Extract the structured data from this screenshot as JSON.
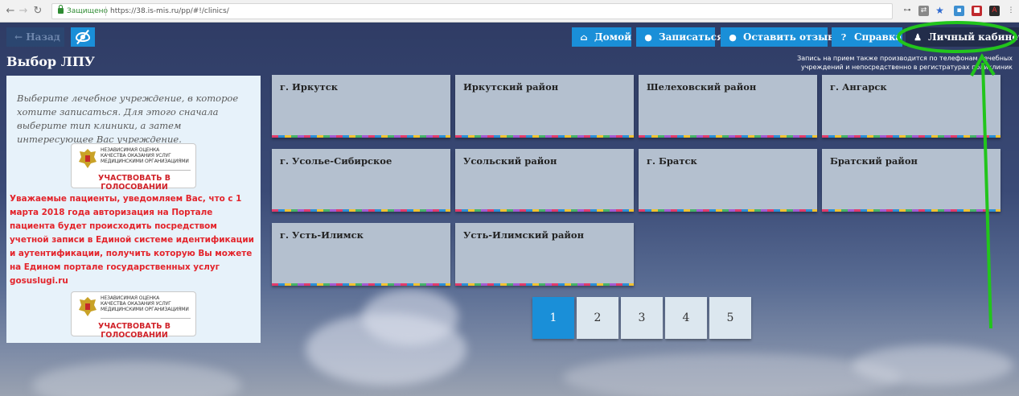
{
  "browser": {
    "secure_label": "Защищено",
    "url": "https://38.is-mis.ru/pp/#!/clinics/"
  },
  "topnav": {
    "back_label": "Назад",
    "home_label": "Домой",
    "signup_label": "Записаться",
    "feedback_label": "Оставить отзыв",
    "help_label": "Справка",
    "cabinet_label": "Личный кабинет"
  },
  "page": {
    "title": "Выбор ЛПУ",
    "note": "Запись на прием также производится по телефонам лечебных учреждений и непосредственно в регистратурах поликлиник"
  },
  "leftpanel": {
    "intro": "Выберите лечебное учреждение, в которое хотите записаться. Для этого сначала выберите тип клиники, а затем интересующее Вас учреждение.",
    "vote_lines": [
      "НЕЗАВИСИМАЯ ОЦЕНКА",
      "КАЧЕСТВА ОКАЗАНИЯ УСЛУГ",
      "МЕДИЦИНСКИМИ ОРГАНИЗАЦИЯМИ"
    ],
    "vote_button": "УЧАСТВОВАТЬ В ГОЛОСОВАНИИ",
    "notice": "Уважаемые пациенты, уведомляем Вас, что с 1 марта 2018 года авторизация на Портале пациента будет происходить посредством учетной записи в Единой системе идентификации и аутентификации, получить которую Вы можете на Едином портале государственных услуг gosuslugi.ru"
  },
  "tiles": [
    "г. Иркутск",
    "Иркутский район",
    "Шелеховский район",
    "г. Ангарск",
    "г. Усолье-Сибирское",
    "Усольский район",
    "г. Братск",
    "Братский район",
    "г. Усть-Илимск",
    "Усть-Илимский район"
  ],
  "pagination": [
    "1",
    "2",
    "3",
    "4",
    "5"
  ],
  "pagination_active": "1",
  "colors": {
    "accent": "#1a8fd8",
    "notice": "#e3242b",
    "annotation": "#22c51c"
  }
}
